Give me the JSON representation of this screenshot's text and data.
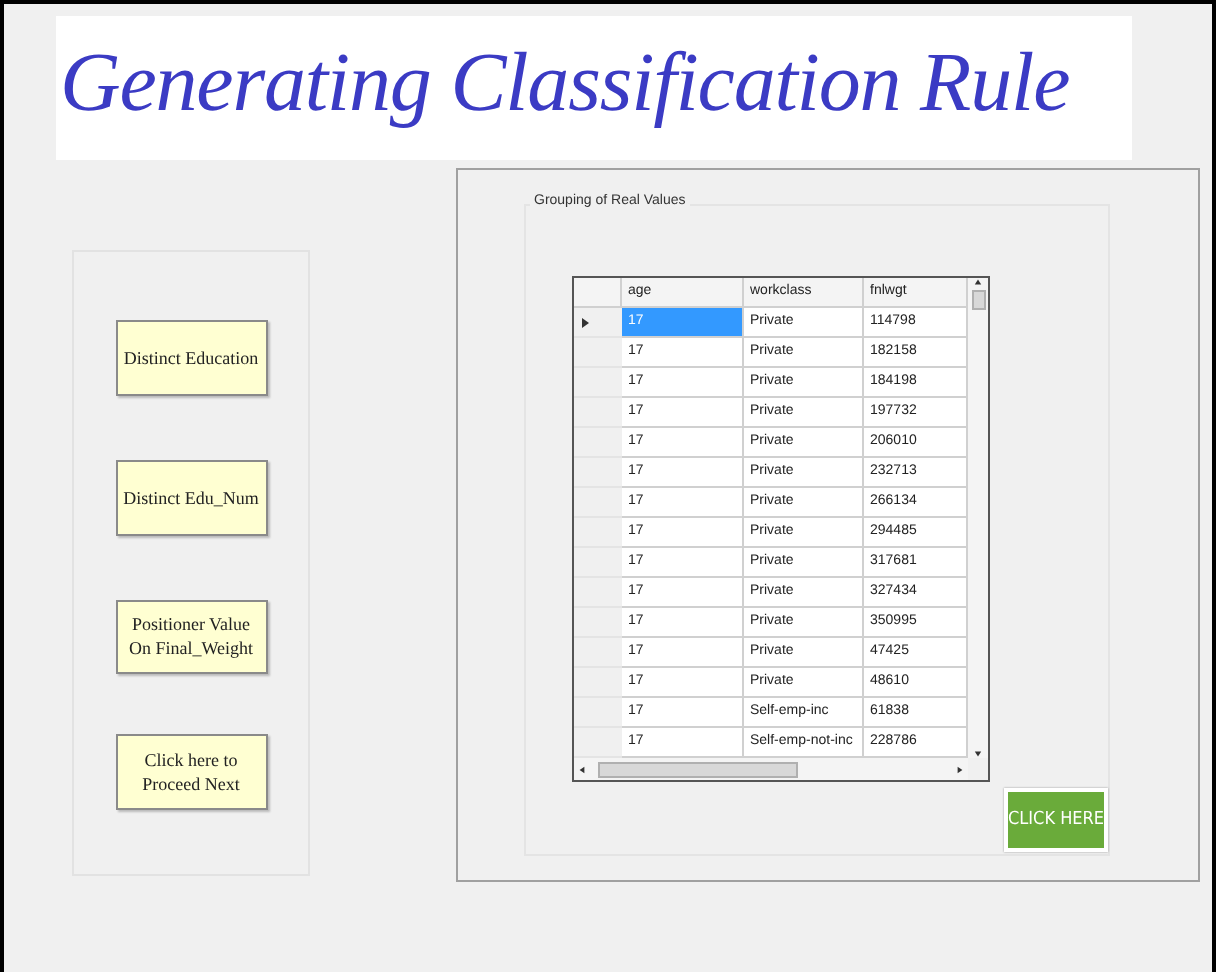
{
  "title": "Generating Classification Rule",
  "side_buttons": [
    "Distinct Education",
    "Distinct Edu_Num",
    "Positioner Value On Final_Weight",
    "Click here to Proceed Next"
  ],
  "group": {
    "label": "Grouping of Real Values"
  },
  "table": {
    "columns": [
      "age",
      "workclass",
      "fnlwgt"
    ],
    "rows": [
      {
        "cells": [
          "17",
          "Private",
          "114798"
        ],
        "selected": true
      },
      {
        "cells": [
          "17",
          "Private",
          "182158"
        ],
        "selected": false
      },
      {
        "cells": [
          "17",
          "Private",
          "184198"
        ],
        "selected": false
      },
      {
        "cells": [
          "17",
          "Private",
          "197732"
        ],
        "selected": false
      },
      {
        "cells": [
          "17",
          "Private",
          "206010"
        ],
        "selected": false
      },
      {
        "cells": [
          "17",
          "Private",
          "232713"
        ],
        "selected": false
      },
      {
        "cells": [
          "17",
          "Private",
          "266134"
        ],
        "selected": false
      },
      {
        "cells": [
          "17",
          "Private",
          "294485"
        ],
        "selected": false
      },
      {
        "cells": [
          "17",
          "Private",
          "317681"
        ],
        "selected": false
      },
      {
        "cells": [
          "17",
          "Private",
          "327434"
        ],
        "selected": false
      },
      {
        "cells": [
          "17",
          "Private",
          "350995"
        ],
        "selected": false
      },
      {
        "cells": [
          "17",
          "Private",
          "47425"
        ],
        "selected": false
      },
      {
        "cells": [
          "17",
          "Private",
          "48610"
        ],
        "selected": false
      },
      {
        "cells": [
          "17",
          "Self-emp-inc",
          "61838"
        ],
        "selected": false
      },
      {
        "cells": [
          "17",
          "Self-emp-not-inc",
          "228786"
        ],
        "selected": false
      }
    ]
  },
  "action_button": "CLICK HERE"
}
